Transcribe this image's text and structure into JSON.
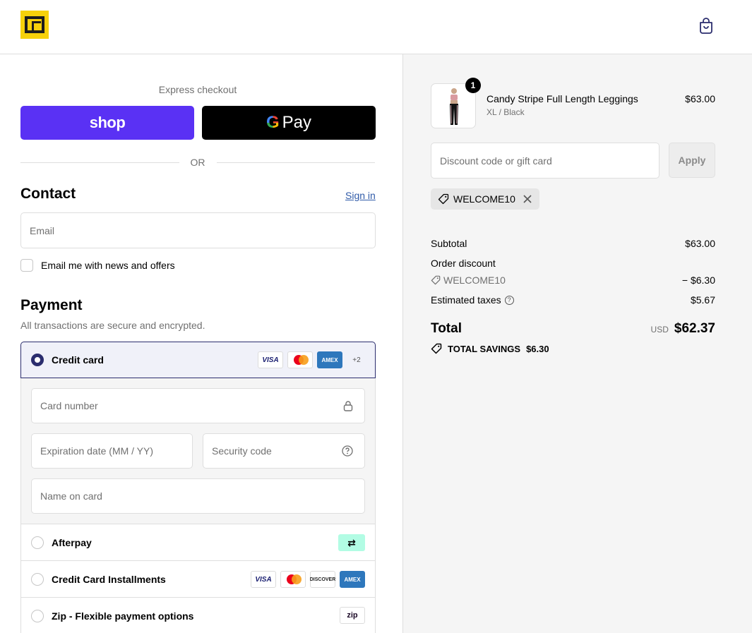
{
  "header": {
    "logo_icon": "brand-logo",
    "cart_icon": "shopping-bag-icon"
  },
  "express": {
    "label": "Express checkout",
    "shop_label": "shop",
    "gpay_g": "G",
    "gpay_label": "Pay",
    "or_label": "OR"
  },
  "contact": {
    "title": "Contact",
    "signin_label": "Sign in",
    "email_placeholder": "Email",
    "newsletter_label": "Email me with news and offers"
  },
  "payment": {
    "title": "Payment",
    "subtitle": "All transactions are secure and encrypted.",
    "credit_card_label": "Credit card",
    "card_brands": [
      "VISA",
      "AMEX"
    ],
    "more_cards": "+2",
    "card_number_placeholder": "Card number",
    "expiry_placeholder": "Expiration date (MM / YY)",
    "security_placeholder": "Security code",
    "name_placeholder": "Name on card",
    "afterpay_label": "Afterpay",
    "installments_label": "Credit Card Installments",
    "installment_brands": [
      "VISA",
      "DISCOVER",
      "AMEX"
    ],
    "zip_label": "Zip - Flexible payment options",
    "zip_logo": "zip"
  },
  "summary": {
    "product_name": "Candy Stripe Full Length Leggings",
    "product_variant": "XL / Black",
    "product_price": "$63.00",
    "quantity": "1",
    "discount_placeholder": "Discount code or gift card",
    "apply_label": "Apply",
    "applied_code": "WELCOME10",
    "subtotal_label": "Subtotal",
    "subtotal_value": "$63.00",
    "order_discount_label": "Order discount",
    "discount_code": "WELCOME10",
    "discount_value": "− $6.30",
    "taxes_label": "Estimated taxes",
    "taxes_value": "$5.67",
    "total_label": "Total",
    "currency": "USD",
    "total_value": "$62.37",
    "savings_label": "TOTAL SAVINGS",
    "savings_value": "$6.30"
  },
  "colors": {
    "shop": "#5a31f4",
    "selected_border": "#2b2d6e",
    "summary_bg": "#f5f5f5"
  }
}
